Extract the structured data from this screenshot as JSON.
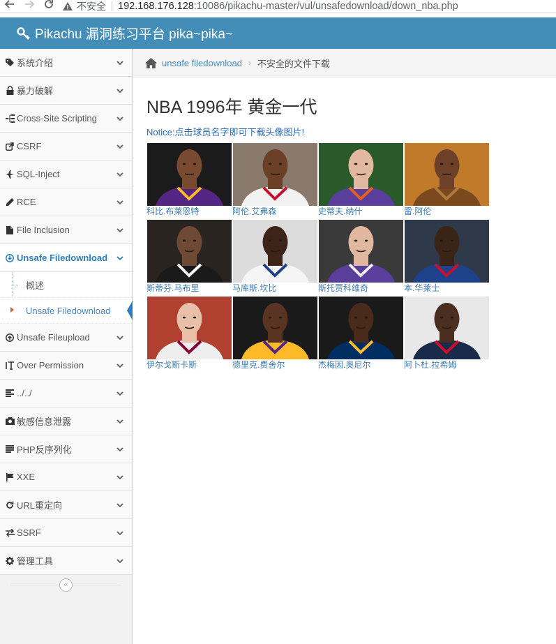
{
  "browser": {
    "insecure_label": "不安全",
    "url_host": "192.168.176.128",
    "url_rest": ":10086/pikachu-master/vul/unsafedownload/down_nba.php"
  },
  "header": {
    "title": "Pikachu 漏洞练习平台 pika~pika~",
    "color": "#438eb9"
  },
  "sidebar": {
    "items": [
      {
        "label": "系统介绍",
        "icon": "tags-icon"
      },
      {
        "label": "暴力破解",
        "icon": "lock-icon"
      },
      {
        "label": "Cross-Site Scripting",
        "icon": "sitemap-icon"
      },
      {
        "label": "CSRF",
        "icon": "share-icon"
      },
      {
        "label": "SQL-Inject",
        "icon": "plane-icon"
      },
      {
        "label": "RCE",
        "icon": "pencil-icon"
      },
      {
        "label": "File Inclusion",
        "icon": "file-icon"
      },
      {
        "label": "Unsafe Filedownload",
        "icon": "download-icon"
      },
      {
        "label": "Unsafe Fileupload",
        "icon": "upload-icon"
      },
      {
        "label": "Over Permission",
        "icon": "text-height-icon"
      },
      {
        "label": "../../",
        "icon": "align-left-icon"
      },
      {
        "label": "敏感信息泄露",
        "icon": "camera-icon"
      },
      {
        "label": "PHP反序列化",
        "icon": "align-justify-icon"
      },
      {
        "label": "XXE",
        "icon": "flag-icon"
      },
      {
        "label": "URL重定向",
        "icon": "repeat-icon"
      },
      {
        "label": "SSRF",
        "icon": "exchange-icon"
      },
      {
        "label": "管理工具",
        "icon": "cog-icon"
      }
    ],
    "submenu": [
      {
        "label": "概述"
      },
      {
        "label": "Unsafe Filedownload"
      }
    ]
  },
  "breadcrumb": {
    "link": "unsafe filedownload",
    "current": "不安全的文件下载"
  },
  "main": {
    "title": "NBA 1996年 黄金一代",
    "notice": "Notice:点击球员名字即可下载头像图片!",
    "players": [
      {
        "name": "科比.布莱恩特",
        "jersey": "#552583",
        "trim": "#fdb927",
        "bg": "#1b1b1b",
        "skin": "#7a4a30"
      },
      {
        "name": "阿伦.艾弗森",
        "jersey": "#f2f2f2",
        "trim": "#c8102e",
        "bg": "#8a7a6e",
        "skin": "#6b4026"
      },
      {
        "name": "史蒂夫.纳什",
        "jersey": "#5a3e9b",
        "trim": "#e56020",
        "bg": "#2a5a2a",
        "skin": "#e2b8a0"
      },
      {
        "name": "雷.阿伦",
        "jersey": "#7a4a1e",
        "trim": "#b07a3a",
        "bg": "#c07a2a",
        "skin": "#6e4028"
      },
      {
        "name": "斯蒂芬.马布里",
        "jersey": "#1a1a1a",
        "trim": "#ffffff",
        "bg": "#2a2420",
        "skin": "#6e4a34"
      },
      {
        "name": "马库斯.坎比",
        "jersey": "#f5f5f5",
        "trim": "#1d428a",
        "bg": "#dcdcdc",
        "skin": "#3e2418"
      },
      {
        "name": "斯托贾科维奇",
        "jersey": "#5a3e9b",
        "trim": "#eeeeee",
        "bg": "#3a3a3a",
        "skin": "#e0b8a0"
      },
      {
        "name": "本.华莱士",
        "jersey": "#1d428a",
        "trim": "#c8102e",
        "bg": "#2e3a4a",
        "skin": "#3a2418"
      },
      {
        "name": "伊尔戈斯卡斯",
        "jersey": "#eeeeee",
        "trim": "#860038",
        "bg": "#b04030",
        "skin": "#e8c0a8"
      },
      {
        "name": "德里克.费舍尔",
        "jersey": "#fdb927",
        "trim": "#552583",
        "bg": "#1a1a1a",
        "skin": "#5a3422"
      },
      {
        "name": "杰梅因.奥尼尔",
        "jersey": "#002d62",
        "trim": "#fdbb30",
        "bg": "#1a1a1a",
        "skin": "#4a2a1a"
      },
      {
        "name": "阿卜杜.拉希姆",
        "jersey": "#1a2a4a",
        "trim": "#c8102e",
        "bg": "#e8e8e8",
        "skin": "#4a2e20"
      }
    ]
  }
}
